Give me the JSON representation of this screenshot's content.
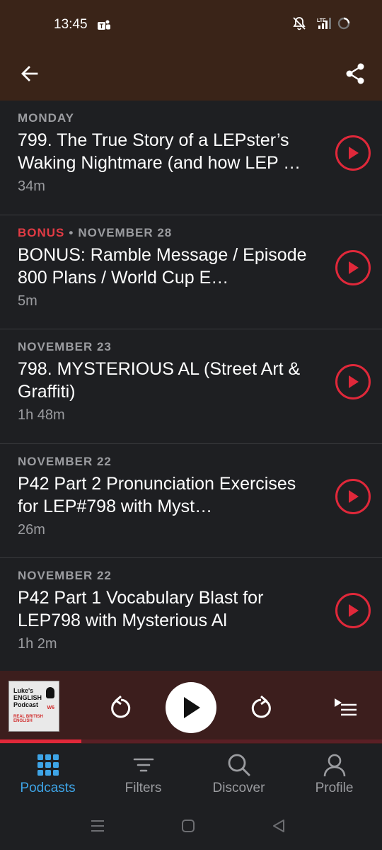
{
  "status_bar": {
    "time": "13:45",
    "icons": [
      "teams-icon",
      "mute-icon",
      "lte-signal-icon",
      "battery-icon"
    ],
    "network": "LTE"
  },
  "app_bar": {
    "back_icon": "arrow-left-icon",
    "share_icon": "share-icon",
    "background": "#3a2418"
  },
  "episodes": [
    {
      "date": "MONDAY",
      "badge": "",
      "title": "799. The True Story of a LEPster’s Waking Nightmare (and how LEP …",
      "duration": "34m"
    },
    {
      "date": "NOVEMBER 28",
      "badge": "BONUS",
      "title": "BONUS: Ramble Message / Episode 800 Plans / World Cup E…",
      "duration": "5m"
    },
    {
      "date": "NOVEMBER 23",
      "badge": "",
      "title": "798. MYSTERIOUS AL (Street Art & Graffiti)",
      "duration": "1h 48m"
    },
    {
      "date": "NOVEMBER 22",
      "badge": "",
      "title": "P42 Part 2 Pronunciation Exercises for LEP#798 with Myst…",
      "duration": "26m"
    },
    {
      "date": "NOVEMBER 22",
      "badge": "",
      "title": "P42 Part 1 Vocabulary Blast for LEP798 with Mysterious Al",
      "duration": "1h 2m"
    }
  ],
  "player": {
    "artwork": {
      "line1": "Luke's",
      "line2": "ENGLISH",
      "line3": "Podcast",
      "tag": "REAL BRITISH ENGLISH",
      "badge": "W6"
    },
    "progress": 0.213,
    "accent": "#e0283a",
    "background": "#3c1e1d"
  },
  "tabs": [
    {
      "label": "Podcasts",
      "icon": "grid-icon",
      "active": true
    },
    {
      "label": "Filters",
      "icon": "filter-icon",
      "active": false
    },
    {
      "label": "Discover",
      "icon": "search-icon",
      "active": false
    },
    {
      "label": "Profile",
      "icon": "profile-icon",
      "active": false
    }
  ],
  "colors": {
    "active_tab": "#3ea4e6",
    "bonus": "#e23b44",
    "background": "#1e1f22"
  }
}
